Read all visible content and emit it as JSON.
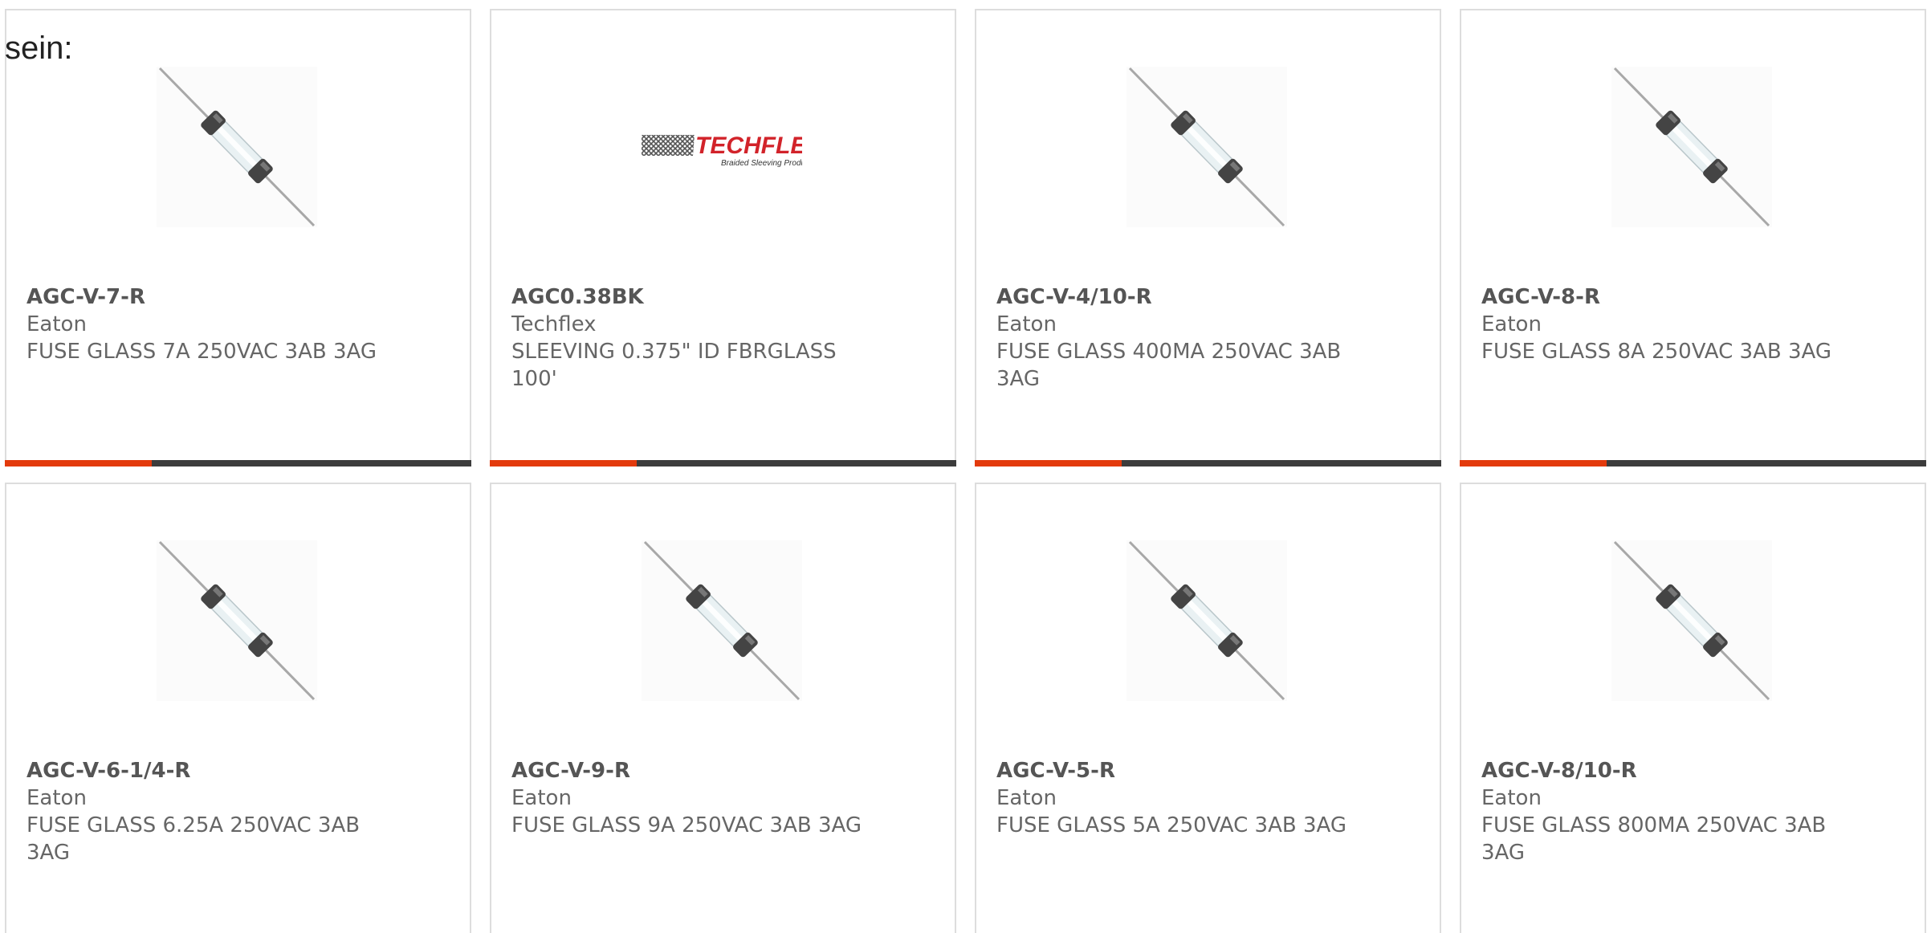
{
  "intro_text": "sein:",
  "colors": {
    "accent": "#e33a0c",
    "bar": "#3c3c3c",
    "card_border": "#dddddd",
    "text": "#666666",
    "part_number": "#555555"
  },
  "products": [
    {
      "part_number": "AGC-V-7-R",
      "manufacturer": "Eaton",
      "description": "FUSE GLASS 7A 250VAC 3AB 3AG",
      "image": "glass-fuse-icon"
    },
    {
      "part_number": "AGC0.38BK",
      "manufacturer": "Techflex",
      "description": "SLEEVING 0.375\" ID FBRGLASS 100'",
      "image": "techflex-logo",
      "logo_text": "TECHFLEX",
      "logo_subtext": "Braided Sleeving Products"
    },
    {
      "part_number": "AGC-V-4/10-R",
      "manufacturer": "Eaton",
      "description": "FUSE GLASS 400MA 250VAC 3AB 3AG",
      "image": "glass-fuse-icon"
    },
    {
      "part_number": "AGC-V-8-R",
      "manufacturer": "Eaton",
      "description": "FUSE GLASS 8A 250VAC 3AB 3AG",
      "image": "glass-fuse-icon"
    },
    {
      "part_number": "AGC-V-6-1/4-R",
      "manufacturer": "Eaton",
      "description": "FUSE GLASS 6.25A 250VAC 3AB 3AG",
      "image": "glass-fuse-icon"
    },
    {
      "part_number": "AGC-V-9-R",
      "manufacturer": "Eaton",
      "description": "FUSE GLASS 9A 250VAC 3AB 3AG",
      "image": "glass-fuse-icon"
    },
    {
      "part_number": "AGC-V-5-R",
      "manufacturer": "Eaton",
      "description": "FUSE GLASS 5A 250VAC 3AB 3AG",
      "image": "glass-fuse-icon"
    },
    {
      "part_number": "AGC-V-8/10-R",
      "manufacturer": "Eaton",
      "description": "FUSE GLASS 800MA 250VAC 3AB 3AG",
      "image": "glass-fuse-icon"
    }
  ]
}
